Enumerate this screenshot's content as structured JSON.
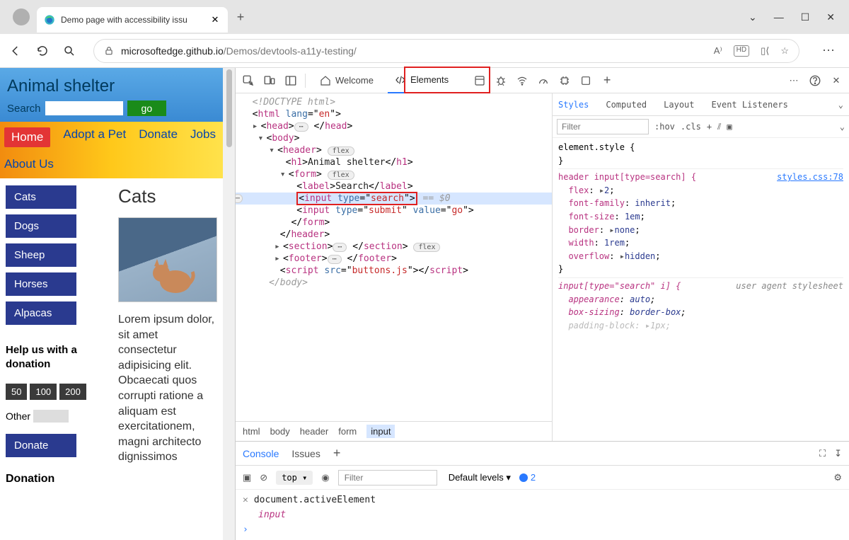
{
  "window": {
    "tab_title": "Demo page with accessibility issu",
    "url_domain": "microsoftedge.github.io",
    "url_path": "/Demos/devtools-a11y-testing/"
  },
  "page": {
    "title": "Animal shelter",
    "search_label": "Search",
    "go_label": "go",
    "nav": [
      "Home",
      "Adopt a Pet",
      "Donate",
      "Jobs",
      "About Us"
    ],
    "categories": [
      "Cats",
      "Dogs",
      "Sheep",
      "Horses",
      "Alpacas"
    ],
    "help_heading": "Help us with a donation",
    "amounts": [
      "50",
      "100",
      "200"
    ],
    "other_label": "Other",
    "donate_label": "Donate",
    "donation_heading": "Donation",
    "main_heading": "Cats",
    "lorem": "Lorem ipsum dolor, sit amet consectetur adipisicing elit. Obcaecati quos corrupti ratione a aliquam est exercitationem, magni architecto dignissimos"
  },
  "devtools": {
    "tabs": {
      "welcome": "Welcome",
      "elements": "Elements"
    },
    "dom": {
      "doctype": "<!DOCTYPE html>",
      "html_open": "html",
      "html_lang": "en",
      "head": "head",
      "body": "body",
      "header": "header",
      "flex": "flex",
      "h1_tag": "h1",
      "h1_text": "Animal shelter",
      "form": "form",
      "label_tag": "label",
      "label_text": "Search",
      "input": "input",
      "type_attr": "type",
      "search_val": "search",
      "submit_val": "submit",
      "value_attr": "value",
      "go_val": "go",
      "eq0": " == $0",
      "section": "section",
      "footer": "footer",
      "script": "script",
      "src_attr": "src",
      "buttons_js": "buttons.js",
      "crumbs": [
        "html",
        "body",
        "header",
        "form",
        "input"
      ]
    },
    "styles": {
      "tabs": [
        "Styles",
        "Computed",
        "Layout",
        "Event Listeners"
      ],
      "filter_ph": "Filter",
      "hov": ":hov",
      "cls": ".cls",
      "el_style": "element.style {",
      "rule_sel": "header input[type=search] {",
      "rule_link": "styles.css:78",
      "rules": [
        {
          "p": "flex",
          "v": "2"
        },
        {
          "p": "font-family",
          "v": "inherit"
        },
        {
          "p": "font-size",
          "v": "1em"
        },
        {
          "p": "border",
          "v": "none"
        },
        {
          "p": "width",
          "v": "1rem"
        },
        {
          "p": "overflow",
          "v": "hidden"
        }
      ],
      "ua_sel": "input[type=\"search\" i] {",
      "ua_label": "user agent stylesheet",
      "ua_rules": [
        {
          "p": "appearance",
          "v": "auto"
        },
        {
          "p": "box-sizing",
          "v": "border-box"
        },
        {
          "p": "padding-block",
          "v": "1px"
        }
      ]
    },
    "drawer": {
      "tabs": [
        "Console",
        "Issues"
      ],
      "top": "top",
      "filter_ph": "Filter",
      "levels": "Default levels",
      "warn_count": "2",
      "expr": "document.activeElement",
      "result": "input"
    }
  }
}
